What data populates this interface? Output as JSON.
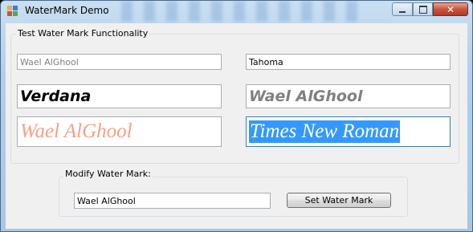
{
  "window": {
    "title": "WaterMark Demo"
  },
  "test_group": {
    "title": "Test Water Mark Functionality",
    "fields": {
      "f1": "Wael AlGhool",
      "f2": "Tahoma",
      "f3": "Verdana",
      "f4": "Wael AlGhool",
      "f5": "Wael AlGhool",
      "f6": "Times New Roman"
    }
  },
  "modify_group": {
    "title": "Modify Water Mark:",
    "input_value": "Wael AlGhool",
    "button_label": "Set Water Mark"
  },
  "colors": {
    "watermark_gray": "#808080",
    "watermark_salmon": "#f4a284",
    "selection_blue": "#3399ff"
  }
}
